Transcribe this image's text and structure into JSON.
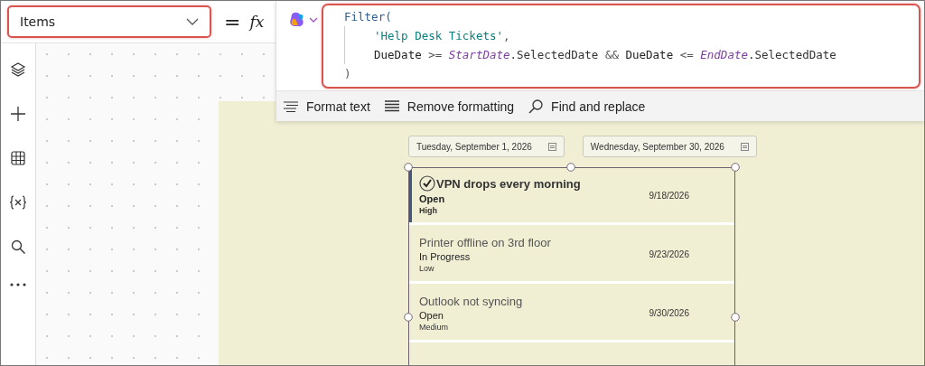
{
  "property_selector": {
    "value": "Items"
  },
  "formula_bar": {
    "equals": "=",
    "fx": "fx",
    "lines": [
      [
        {
          "kind": "func",
          "text": "Filter("
        }
      ],
      [
        {
          "kind": "string",
          "text": "'Help Desk Tickets'"
        },
        {
          "kind": "punct",
          "text": ","
        }
      ],
      [
        {
          "kind": "field",
          "text": "DueDate"
        },
        {
          "kind": "op",
          "text": " >= "
        },
        {
          "kind": "control",
          "text": "StartDate"
        },
        {
          "kind": "prop",
          "text": ".SelectedDate"
        },
        {
          "kind": "op",
          "text": " && "
        },
        {
          "kind": "field",
          "text": "DueDate"
        },
        {
          "kind": "op",
          "text": " <= "
        },
        {
          "kind": "control",
          "text": "EndDate"
        },
        {
          "kind": "prop",
          "text": ".SelectedDate"
        }
      ],
      [
        {
          "kind": "punct",
          "text": ")"
        }
      ]
    ]
  },
  "toolbar": [
    "Format text",
    "Remove formatting",
    "Find and replace"
  ],
  "date_pickers": [
    {
      "value": "Tuesday, September 1, 2026"
    },
    {
      "value": "Wednesday, September 30, 2026"
    }
  ],
  "gallery": {
    "rows": [
      {
        "title": "VPN drops every morning",
        "status": "Open",
        "priority": "High",
        "due": "9/18/2026",
        "selected": true
      },
      {
        "title": "Printer offline on 3rd floor",
        "status": "In Progress",
        "priority": "Low",
        "due": "9/23/2026",
        "selected": false
      },
      {
        "title": "Outlook not syncing",
        "status": "Open",
        "priority": "Medium",
        "due": "9/30/2026",
        "selected": false
      }
    ]
  }
}
